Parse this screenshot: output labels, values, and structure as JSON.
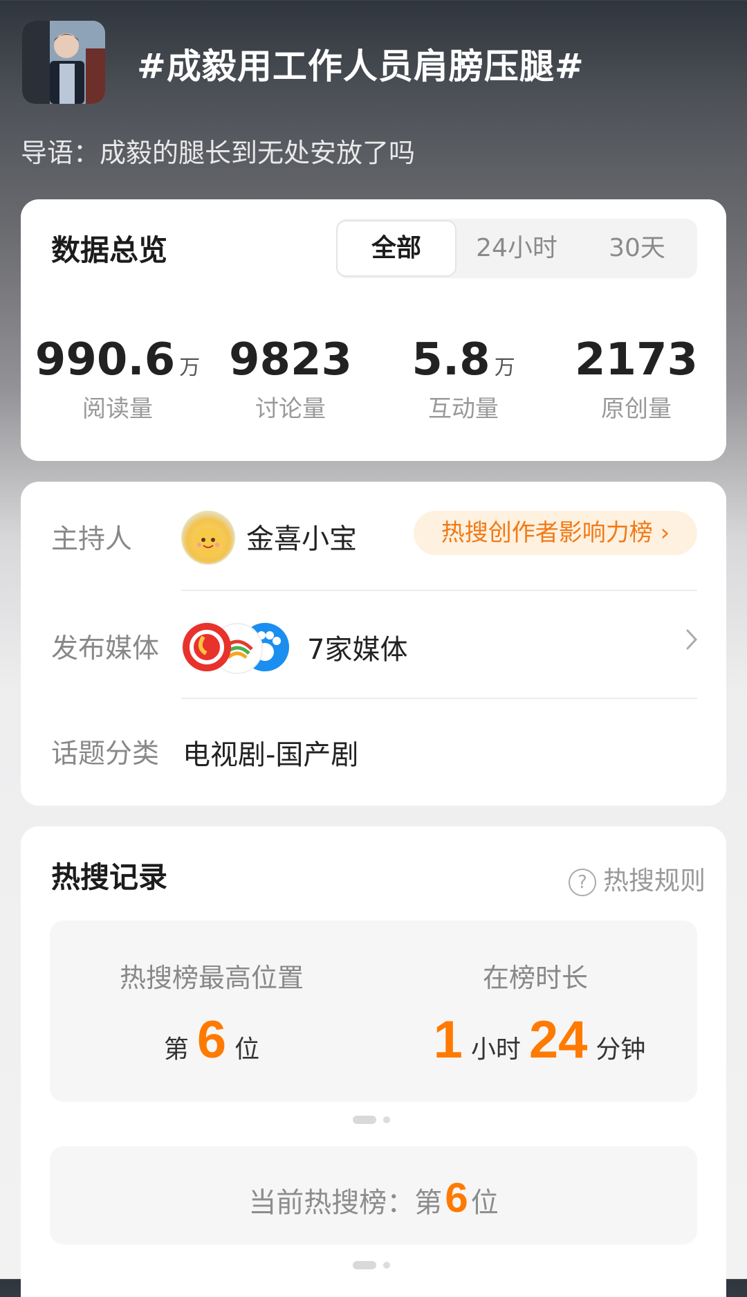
{
  "topic": {
    "title": "#成毅用工作人员肩膀压腿#",
    "guide": "导语：成毅的腿长到无处安放了吗"
  },
  "overview": {
    "title": "数据总览",
    "tabs": [
      "全部",
      "24小时",
      "30天"
    ],
    "active_tab": "全部",
    "stats": [
      {
        "value": "990.6",
        "unit": "万",
        "label": "阅读量"
      },
      {
        "value": "9823",
        "unit": "",
        "label": "讨论量"
      },
      {
        "value": "5.8",
        "unit": "万",
        "label": "互动量"
      },
      {
        "value": "2173",
        "unit": "",
        "label": "原创量"
      }
    ]
  },
  "info": {
    "host_label": "主持人",
    "host_name": "金喜小宝",
    "host_badge": "热搜创作者影响力榜 ›",
    "media_label": "发布媒体",
    "media_text": "7家媒体",
    "category_label": "话题分类",
    "category_value": "电视剧-国产剧"
  },
  "hot": {
    "title": "热搜记录",
    "rule_label": "热搜规则",
    "peak_header": "热搜榜最高位置",
    "peak_prefix": "第",
    "peak_value": "6",
    "peak_suffix": "位",
    "duration_header": "在榜时长",
    "duration_hours": "1",
    "hours_unit": "小时",
    "duration_minutes": "24",
    "minutes_unit": "分钟",
    "current_prefix": "当前热搜榜：第",
    "current_value": "6",
    "current_suffix": "位"
  },
  "colors": {
    "accent": "#ff7a00",
    "pill_bg": "#fff1df"
  },
  "icons": [
    "question-circle-icon",
    "chevron-right-icon"
  ]
}
